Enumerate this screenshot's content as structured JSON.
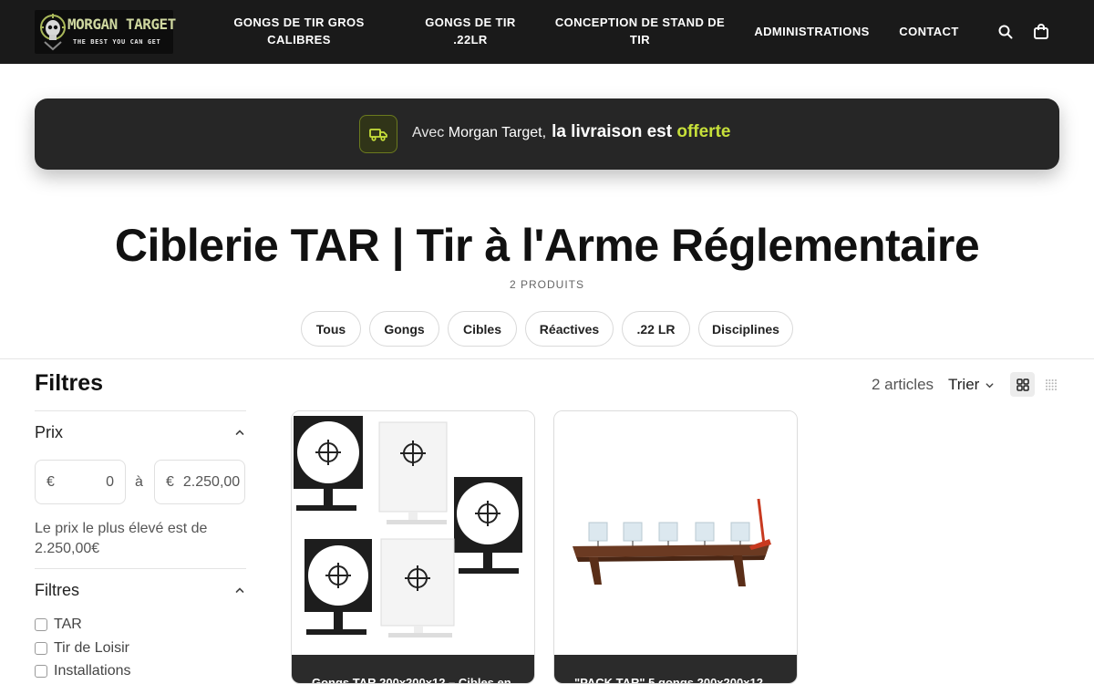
{
  "header": {
    "logo": {
      "title": "MORGAN TARGET",
      "subtitle": "THE BEST YOU CAN GET"
    },
    "nav": [
      {
        "label": "GONGS DE TIR GROS CALIBRES"
      },
      {
        "label": "GONGS DE TIR .22LR"
      },
      {
        "label": "CONCEPTION DE STAND DE TIR"
      },
      {
        "label": "ADMINISTRATIONS"
      },
      {
        "label": "CONTACT"
      }
    ],
    "icons": {
      "search": "search-icon",
      "cart": "shopping-bag-icon"
    }
  },
  "promo": {
    "icon": "truck-icon",
    "part1": "Avec ",
    "part2": "Morgan Target,",
    "part3": "la livraison est ",
    "part4": "offerte",
    "accent_color": "#c7e03a"
  },
  "collection": {
    "title": "Ciblerie TAR | Tir à l'Arme Réglementaire",
    "product_count": "2 PRODUITS"
  },
  "categories": [
    {
      "label": "Tous"
    },
    {
      "label": "Gongs"
    },
    {
      "label": "Cibles"
    },
    {
      "label": "Réactives"
    },
    {
      "label": ".22 LR"
    },
    {
      "label": "Disciplines"
    }
  ],
  "sidebar": {
    "title": "Filtres",
    "price": {
      "heading": "Prix",
      "currency": "€",
      "min_value": "0",
      "separator": "à",
      "max_value": "2.250,00",
      "max_note": "Le prix le plus élevé est de 2.250,00€"
    },
    "filters": {
      "heading": "Filtres",
      "options": [
        {
          "label": "TAR",
          "checked": false
        },
        {
          "label": "Tir de Loisir",
          "checked": false
        },
        {
          "label": "Installations",
          "checked": false
        }
      ]
    }
  },
  "toolbar": {
    "article_count": "2 articles",
    "sort_label": "Trier",
    "view_modes": [
      "grid-view-icon",
      "list-view-icon"
    ]
  },
  "products": [
    {
      "title": "Gongs TAR 200x200x12 – Cibles en",
      "image": "tar-gong-targets-image"
    },
    {
      "title": "\"PACK TAR\" 5 gongs 200x200x12",
      "image": "tar-pack-rack-image"
    }
  ]
}
